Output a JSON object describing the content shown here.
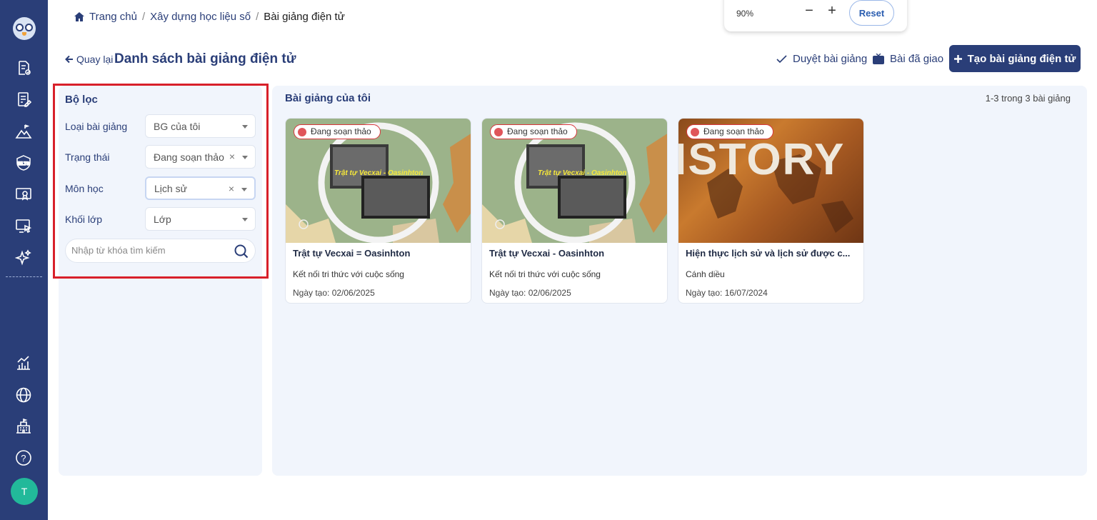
{
  "breadcrumb": {
    "home": "Trang chủ",
    "section": "Xây dựng học liệu số",
    "current": "Bài giảng điện tử",
    "separator": "/"
  },
  "zoom": {
    "level": "90%",
    "minus": "−",
    "plus": "+",
    "reset": "Reset"
  },
  "header": {
    "back": "Quay lại",
    "title": "Danh sách bài giảng điện tử",
    "approve": "Duyệt bài giảng",
    "assigned": "Bài đã giao",
    "create": "Tạo bài giảng điện tử"
  },
  "filter": {
    "title": "Bộ lọc",
    "fields": [
      {
        "label": "Loại bài giảng",
        "value": "BG của tôi"
      },
      {
        "label": "Trạng thái",
        "value": "Đang soạn thảo"
      },
      {
        "label": "Môn học",
        "value": "Lịch sử"
      },
      {
        "label": "Khối lớp",
        "value": "Lớp"
      }
    ],
    "clear_icon": "×",
    "search_placeholder": "Nhập từ khóa tìm kiếm"
  },
  "list": {
    "title": "Bài giảng của tôi",
    "count": "1-3 trong 3 bài giảng",
    "cards": [
      {
        "status": "Đang soạn thảo",
        "thumb_text": "Trật tự Vecxai - Oasinhton",
        "title": "Trật tự Vecxai = Oasinhton",
        "subtitle": "Kết nối tri thức với cuộc sống",
        "date": "Ngày tạo: 02/06/2025"
      },
      {
        "status": "Đang soạn thảo",
        "thumb_text": "Trật tự Vecxai - Oasinhton",
        "title": "Trật tự Vecxai - Oasinhton",
        "subtitle": "Kết nối tri thức với cuộc sống",
        "date": "Ngày tạo: 02/06/2025"
      },
      {
        "status": "Đang soạn thảo",
        "thumb_text": "ISTORY",
        "title": "Hiện thực lịch sử và lịch sử được c...",
        "subtitle": "Cánh diều",
        "date": "Ngày tạo: 16/07/2024"
      }
    ]
  },
  "sidebar": {
    "avatar": "T",
    "ielts": "IELTS",
    "help": "?"
  },
  "colors": {
    "primary": "#2a3e78",
    "highlight": "#d8202a",
    "status_dot": "#e0555a",
    "avatar": "#22b99a"
  }
}
